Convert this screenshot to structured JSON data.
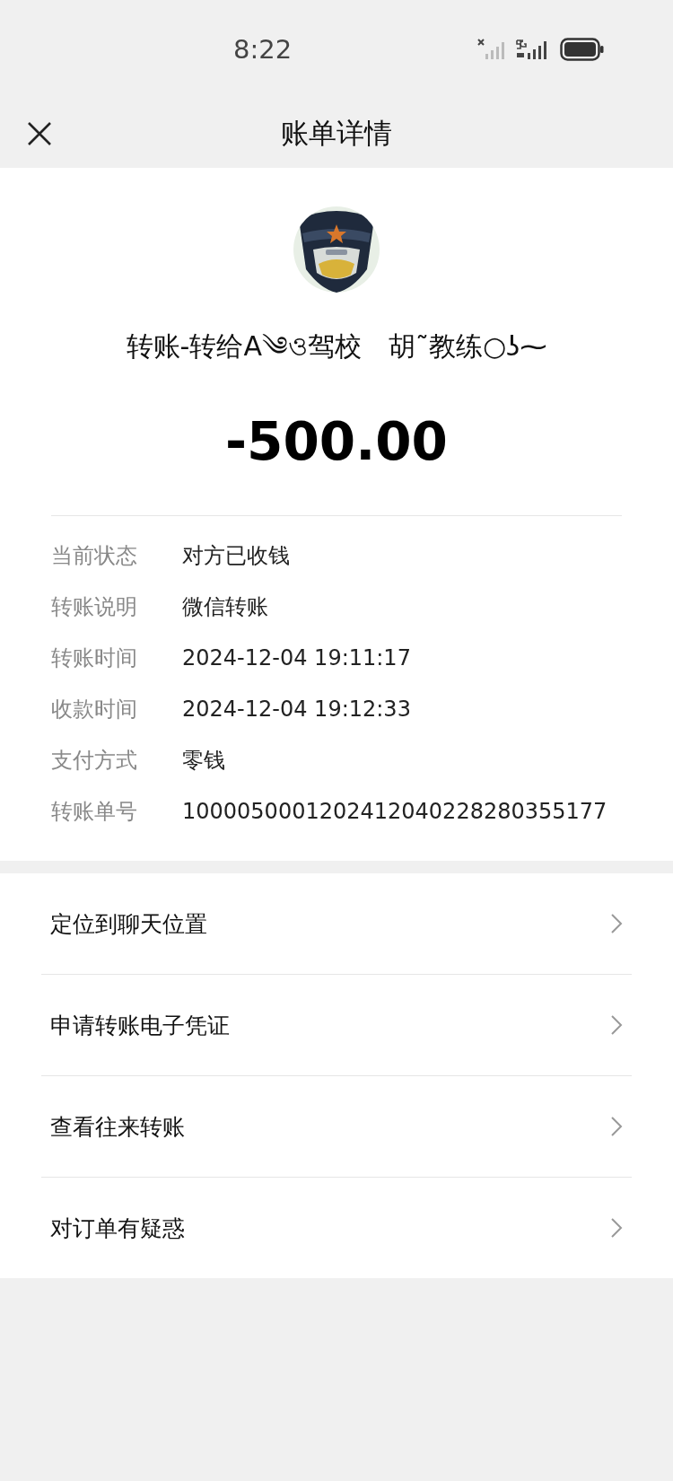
{
  "status_bar": {
    "time": "8:22"
  },
  "nav": {
    "title": "账单详情"
  },
  "header": {
    "title": "转账-转给A༄ও驾校　胡˜教练○ʖ⁓",
    "amount": "-500.00"
  },
  "details": [
    {
      "label": "当前状态",
      "value": "对方已收钱"
    },
    {
      "label": "转账说明",
      "value": "微信转账"
    },
    {
      "label": "转账时间",
      "value": "2024-12-04 19:11:17"
    },
    {
      "label": "收款时间",
      "value": "2024-12-04 19:12:33"
    },
    {
      "label": "支付方式",
      "value": "零钱"
    },
    {
      "label": "转账单号",
      "value": "1000050001202412040228280355177"
    }
  ],
  "menu": [
    {
      "label": "定位到聊天位置"
    },
    {
      "label": "申请转账电子凭证"
    },
    {
      "label": "查看往来转账"
    },
    {
      "label": "对订单有疑惑"
    }
  ]
}
